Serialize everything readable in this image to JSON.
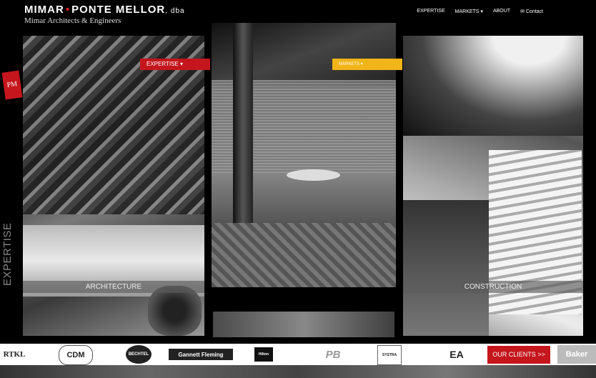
{
  "brand": {
    "name": "MIMAR",
    "dot": "•",
    "partner": "PONTE MELLOR",
    "suffix": ", dba",
    "subtitle": "Mimar Architects & Engineers"
  },
  "nav": {
    "items": [
      "EXPERTISE",
      "MARKETS ▾",
      "ABOUT",
      "✉ Contact"
    ]
  },
  "tags": {
    "expertise": "EXPERTISE ▾",
    "markets": "MARKETS ▾"
  },
  "side_label": "EXPERTISE",
  "pm_logo": "PM",
  "panels": {
    "left_caption": "ARCHITECTURE",
    "right_caption": "CONSTRUCTION"
  },
  "clients": {
    "logos": [
      "RTKL",
      "CDM",
      "BECHTEL",
      "Gannett Fleming",
      "Hilton",
      "PB",
      "SYSTRA",
      "EA",
      "Baker"
    ],
    "cta": "OUR CLIENTS >>"
  },
  "colors": {
    "accent_red": "#c4161c",
    "accent_yellow": "#f1b419",
    "background": "#000000"
  }
}
